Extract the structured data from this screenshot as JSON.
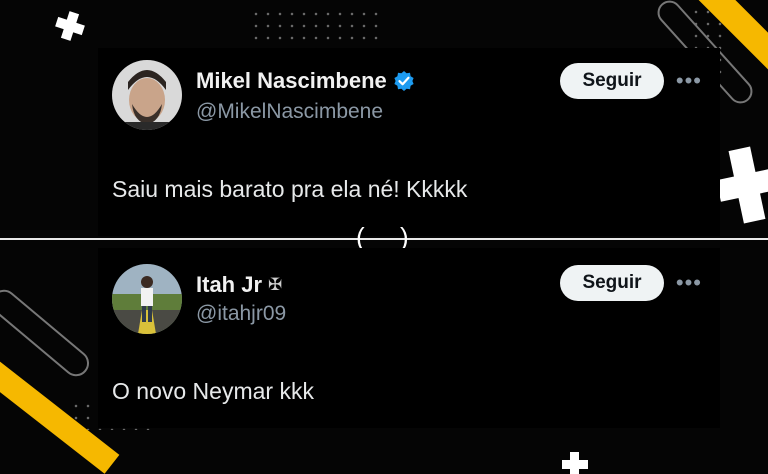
{
  "tweets": [
    {
      "name": "Mikel Nascimbene",
      "verified": true,
      "handle": "@MikelNascimbene",
      "follow_label": "Seguir",
      "more": "•••",
      "text": "Saiu mais barato pra ela né! Kkkkk"
    },
    {
      "name": "Itah Jr",
      "name_symbol": "✠",
      "handle": "@itahjr09",
      "follow_label": "Seguir",
      "more": "•••",
      "text": "O novo Neymar kkk"
    }
  ],
  "divider": {
    "left_paren": "(",
    "right_paren": ")"
  },
  "colors": {
    "accent_yellow": "#f6b800",
    "verified_blue": "#1d9bf0",
    "handle_gray": "#8b98a5",
    "button_bg": "#eff3f4"
  }
}
